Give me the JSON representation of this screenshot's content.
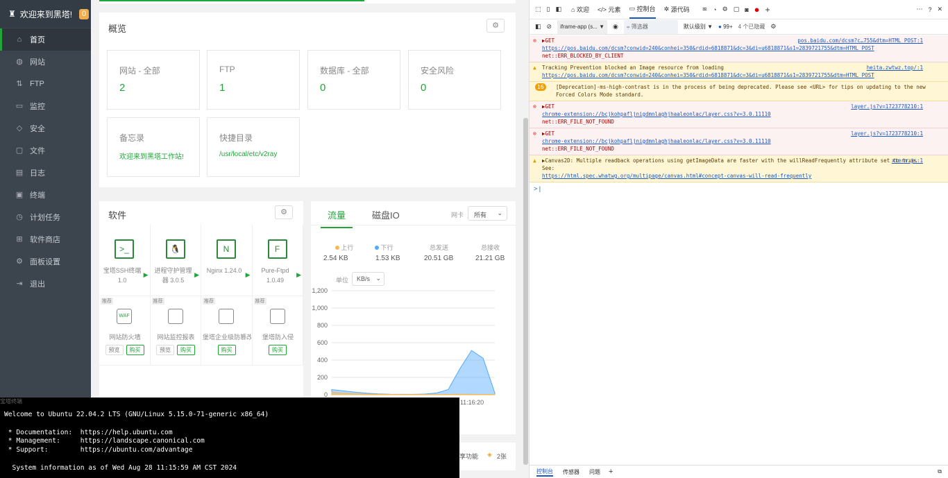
{
  "sidebar": {
    "brand": "欢迎来到黑塔!",
    "badge": "0",
    "items": [
      {
        "label": "首页",
        "icon": "home-icon",
        "glyph": "⌂"
      },
      {
        "label": "网站",
        "icon": "globe-icon",
        "glyph": "◍"
      },
      {
        "label": "FTP",
        "icon": "ftp-icon",
        "glyph": "⇅"
      },
      {
        "label": "监控",
        "icon": "monitor-icon",
        "glyph": "▭"
      },
      {
        "label": "安全",
        "icon": "shield-icon",
        "glyph": "◇"
      },
      {
        "label": "文件",
        "icon": "folder-icon",
        "glyph": "▢"
      },
      {
        "label": "日志",
        "icon": "log-icon",
        "glyph": "▤"
      },
      {
        "label": "终端",
        "icon": "terminal-icon",
        "glyph": "▣"
      },
      {
        "label": "计划任务",
        "icon": "clock-icon",
        "glyph": "◷"
      },
      {
        "label": "软件商店",
        "icon": "store-icon",
        "glyph": "⊞"
      },
      {
        "label": "面板设置",
        "icon": "gear-icon",
        "glyph": "⚙"
      },
      {
        "label": "退出",
        "icon": "logout-icon",
        "glyph": "⇥"
      }
    ]
  },
  "overview": {
    "title": "概览",
    "stats": [
      {
        "label": "网站 - 全部",
        "value": "2"
      },
      {
        "label": "FTP",
        "value": "1"
      },
      {
        "label": "数据库 - 全部",
        "value": "0"
      },
      {
        "label": "安全风险",
        "value": "0"
      }
    ],
    "memo": {
      "label": "备忘录",
      "value": "欢迎来到黑塔工作站!"
    },
    "quickdir": {
      "label": "快捷目录",
      "value": "/usr/local/etc/v2ray"
    }
  },
  "software": {
    "title": "软件",
    "apps": [
      {
        "name": "宝塔SSH终端",
        "version": "1.0",
        "icon": "ssh-terminal-icon"
      },
      {
        "name": "进程守护管理器 3.0.5",
        "version": "",
        "icon": "linux-penguin-icon"
      },
      {
        "name": "Nginx 1.24.0",
        "version": "",
        "icon": "nginx-icon"
      },
      {
        "name": "Pure-Ftpd",
        "version": "1.0.49",
        "icon": "ftp-logo-icon"
      }
    ],
    "recommended": [
      {
        "tag": "推荐",
        "name": "网站防火墙",
        "preview": "预览",
        "buy": "购买",
        "icon": "waf-shield-icon"
      },
      {
        "tag": "推荐",
        "name": "网站监控报表",
        "preview": "预览",
        "buy": "购买",
        "icon": "cube-icon"
      },
      {
        "tag": "推荐",
        "name": "堡塔企业级防篡改",
        "preview": "",
        "buy": "购买",
        "icon": "lock-window-icon"
      },
      {
        "tag": "推荐",
        "name": "堡塔防入侵",
        "preview": "",
        "buy": "购买",
        "icon": "intrusion-icon"
      }
    ]
  },
  "traffic": {
    "tab_active": "流量",
    "tab_other": "磁盘IO",
    "nic_label": "网卡",
    "nic_value": "所有",
    "up_label": "上行",
    "up_value": "2.54 KB",
    "down_label": "下行",
    "down_value": "1.53 KB",
    "sent_label": "总发送",
    "sent_value": "20.51 GB",
    "recv_label": "总接收",
    "recv_value": "21.21 GB",
    "unit_label": "单位",
    "unit_value": "KB/s",
    "up_color": "#f7b851",
    "down_color": "#52a9ff"
  },
  "chart_data": {
    "type": "area",
    "y_ticks": [
      "1,200",
      "1,000",
      "800",
      "600",
      "400",
      "200",
      "0"
    ],
    "ylim": [
      0,
      1200
    ],
    "x_labels": [
      "11:16:20"
    ],
    "series": [
      {
        "name": "上行",
        "color": "#f7b851",
        "values": [
          30,
          20,
          12,
          8,
          5,
          4,
          3,
          3,
          3,
          3,
          4,
          6,
          5,
          4,
          3
        ]
      },
      {
        "name": "下行",
        "color": "#52a9ff",
        "values": [
          60,
          45,
          30,
          18,
          10,
          6,
          5,
          5,
          8,
          20,
          60,
          300,
          510,
          420,
          20
        ]
      }
    ]
  },
  "partial_bottom": {
    "text1": "享功能",
    "text2": "2张"
  },
  "devtools": {
    "tabs": [
      "欢迎",
      "元素",
      "控制台",
      "源代码"
    ],
    "context": "iframe-app (s...",
    "filter_placeholder": "筛选器",
    "level": "默认级别",
    "issues_count": "99+",
    "hidden": "4 个已隐藏",
    "bottom_tabs": [
      "控制台",
      "传感器",
      "问题"
    ],
    "messages": [
      {
        "type": "err",
        "head": "▶GET",
        "link": "https://pos.baidu.com/dcsm?conwid=240&conhei=350&rdid=6818871&dc=3&di=u6818871&s1=2839721755&dtm=HTML_POST",
        "tail": "net::ERR_BLOCKED_BY_CLIENT",
        "src": "pos.baidu.com/dcsm?c…755&dtm=HTML_POST:1"
      },
      {
        "type": "warn",
        "head": "Tracking Prevention blocked an Image resource from loading",
        "link": "https://pos.baidu.com/dcsm?conwid=240&conhei=350&rdid=6818871&dc=3&di=u6818871&s1=2839721755&dtm=HTML_POST",
        "tail": "",
        "src": "heita.zwtwz.top/:1"
      },
      {
        "type": "warn",
        "count": "16",
        "head": "[Deprecation]-ms-high-contrast is in the process of being deprecated. Please see <URL> for tips on updating to the new Forced Colors Mode standard.",
        "link": "",
        "tail": "",
        "src": ""
      },
      {
        "type": "err",
        "head": "▶GET",
        "link": "chrome-extension://bcjkohpafljnigdmnlaghjhaaleonlac/layer.css?v=3.0.11110",
        "tail": "net::ERR_FILE_NOT_FOUND",
        "src": "layer.js?v=1723778210:1"
      },
      {
        "type": "err",
        "head": "▶GET",
        "link": "chrome-extension://bcjkohpafljnigdmnlaghjhaaleonlac/layer.css?v=3.0.11110",
        "tail": "net::ERR_FILE_NOT_FOUND",
        "src": "layer.js?v=1723778210:1"
      },
      {
        "type": "warn",
        "head": "▶Canvas2D: Multiple readback operations using getImageData are faster with the willReadFrequently attribute set to true. See:",
        "link": "https://html.spec.whatwg.org/multipage/canvas.html#concept-canvas-will-read-frequently",
        "tail": "",
        "src": "xterm.js:1"
      }
    ]
  },
  "terminal": {
    "title": "宝塔终端",
    "lines": [
      "Welcome to Ubuntu 22.04.2 LTS (GNU/Linux 5.15.0-71-generic x86_64)",
      "",
      " * Documentation:  https://help.ubuntu.com",
      " * Management:     https://landscape.canonical.com",
      " * Support:        https://ubuntu.com/advantage",
      "",
      "  System information as of Wed Aug 28 11:15:59 AM CST 2024"
    ]
  }
}
